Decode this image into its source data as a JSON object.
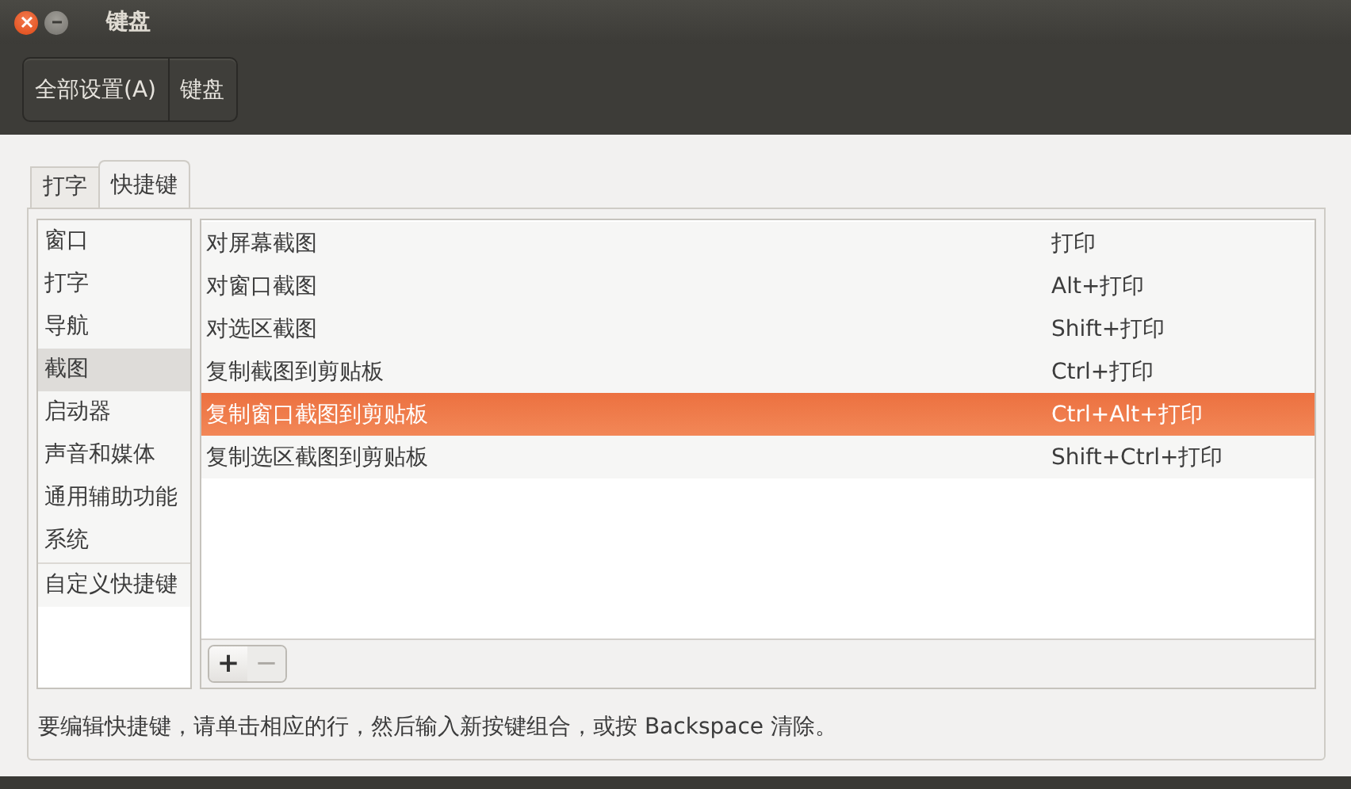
{
  "window": {
    "title": "键盘"
  },
  "toolbar": {
    "breadcrumbs": [
      {
        "label": "全部设置(A)"
      },
      {
        "label": "键盘"
      }
    ]
  },
  "tabs": [
    {
      "label": "打字",
      "selected": false
    },
    {
      "label": "快捷键",
      "selected": true
    }
  ],
  "sidebar": {
    "groups": [
      [
        {
          "label": "窗口",
          "selected": false
        },
        {
          "label": "打字",
          "selected": false
        },
        {
          "label": "导航",
          "selected": false
        },
        {
          "label": "截图",
          "selected": true
        },
        {
          "label": "启动器",
          "selected": false
        },
        {
          "label": "声音和媒体",
          "selected": false
        },
        {
          "label": "通用辅助功能",
          "selected": false
        },
        {
          "label": "系统",
          "selected": false
        }
      ],
      [
        {
          "label": "自定义快捷键",
          "selected": false
        }
      ]
    ]
  },
  "shortcuts": [
    {
      "name": "对屏幕截图",
      "accel": "打印",
      "selected": false
    },
    {
      "name": "对窗口截图",
      "accel": "Alt+打印",
      "selected": false
    },
    {
      "name": "对选区截图",
      "accel": "Shift+打印",
      "selected": false
    },
    {
      "name": "复制截图到剪贴板",
      "accel": "Ctrl+打印",
      "selected": false
    },
    {
      "name": "复制窗口截图到剪贴板",
      "accel": "Ctrl+Alt+打印",
      "selected": true
    },
    {
      "name": "复制选区截图到剪贴板",
      "accel": "Shift+Ctrl+打印",
      "selected": false
    }
  ],
  "list_buttons": [
    {
      "label": "+",
      "disabled": false
    },
    {
      "label": "−",
      "disabled": true
    }
  ],
  "hint": "要编辑快捷键，请单击相应的行，然后输入新按键组合，或按 Backspace 清除。"
}
